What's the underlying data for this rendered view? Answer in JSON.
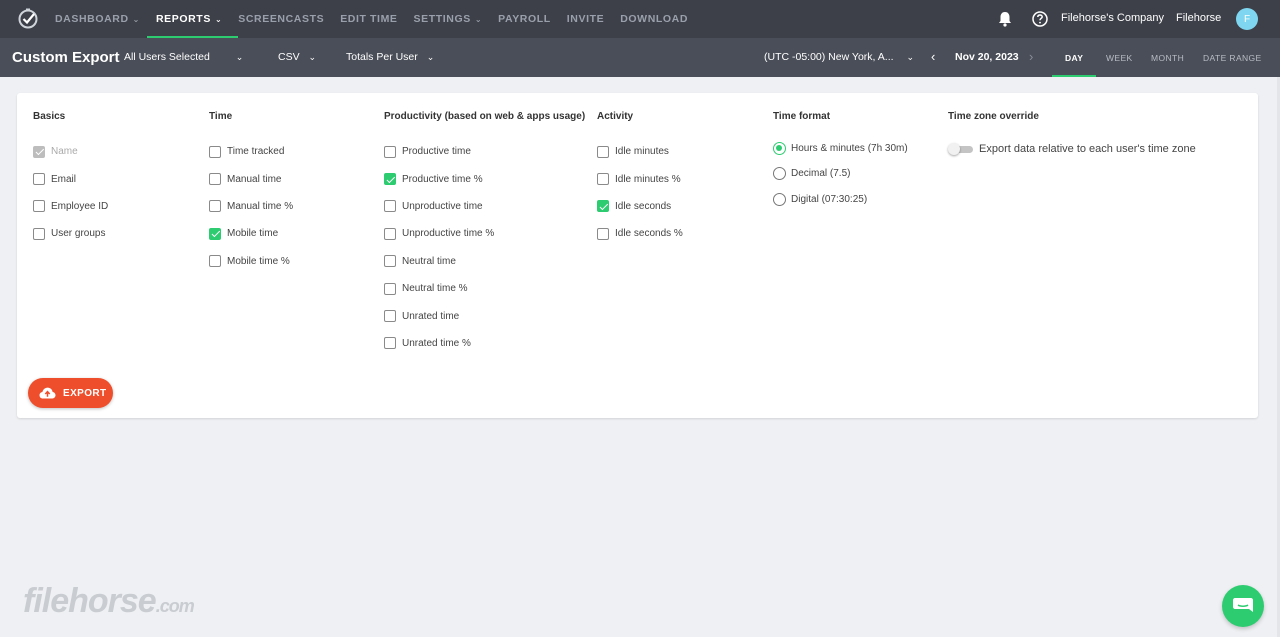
{
  "nav": {
    "items": [
      {
        "label": "DASHBOARD",
        "caret": true,
        "active": false
      },
      {
        "label": "REPORTS",
        "caret": true,
        "active": true
      },
      {
        "label": "SCREENCASTS",
        "caret": false,
        "active": false
      },
      {
        "label": "EDIT TIME",
        "caret": false,
        "active": false
      },
      {
        "label": "SETTINGS",
        "caret": true,
        "active": false
      },
      {
        "label": "PAYROLL",
        "caret": false,
        "active": false
      },
      {
        "label": "INVITE",
        "caret": false,
        "active": false
      },
      {
        "label": "DOWNLOAD",
        "caret": false,
        "active": false
      }
    ],
    "company": "Filehorse's Company",
    "user": "Filehorse",
    "avatar_initial": "F"
  },
  "subbar": {
    "title": "Custom Export",
    "users": "All Users Selected",
    "format": "CSV",
    "grouping": "Totals Per User",
    "timezone": "(UTC -05:00) New York, A...",
    "date": "Nov 20, 2023",
    "ranges": [
      "DAY",
      "WEEK",
      "MONTH",
      "DATE RANGE"
    ],
    "active_range": "DAY"
  },
  "columns": {
    "basics": {
      "title": "Basics",
      "options": [
        {
          "label": "Name",
          "checked": true,
          "disabled": true
        },
        {
          "label": "Email",
          "checked": false
        },
        {
          "label": "Employee ID",
          "checked": false
        },
        {
          "label": "User groups",
          "checked": false
        }
      ]
    },
    "time": {
      "title": "Time",
      "options": [
        {
          "label": "Time tracked",
          "checked": false
        },
        {
          "label": "Manual time",
          "checked": false
        },
        {
          "label": "Manual time %",
          "checked": false
        },
        {
          "label": "Mobile time",
          "checked": true
        },
        {
          "label": "Mobile time %",
          "checked": false
        }
      ]
    },
    "productivity": {
      "title": "Productivity (based on web & apps usage)",
      "options": [
        {
          "label": "Productive time",
          "checked": false
        },
        {
          "label": "Productive time %",
          "checked": true
        },
        {
          "label": "Unproductive time",
          "checked": false
        },
        {
          "label": "Unproductive time %",
          "checked": false
        },
        {
          "label": "Neutral time",
          "checked": false
        },
        {
          "label": "Neutral time %",
          "checked": false
        },
        {
          "label": "Unrated time",
          "checked": false
        },
        {
          "label": "Unrated time %",
          "checked": false
        }
      ]
    },
    "activity": {
      "title": "Activity",
      "options": [
        {
          "label": "Idle minutes",
          "checked": false
        },
        {
          "label": "Idle minutes %",
          "checked": false
        },
        {
          "label": "Idle seconds",
          "checked": true
        },
        {
          "label": "Idle seconds %",
          "checked": false
        }
      ]
    },
    "time_format": {
      "title": "Time format",
      "options": [
        {
          "label": "Hours & minutes (7h 30m)",
          "selected": true
        },
        {
          "label": "Decimal (7.5)",
          "selected": false
        },
        {
          "label": "Digital (07:30:25)",
          "selected": false
        }
      ]
    },
    "tz_override": {
      "title": "Time zone override",
      "toggle_label": "Export data relative to each user's time zone",
      "enabled": false
    }
  },
  "export_label": "EXPORT",
  "watermark": {
    "main": "filehorse",
    "suffix": ".com"
  },
  "colors": {
    "accent": "#2ecc71",
    "export": "#ee4e2b",
    "nav_bg": "#3d4049",
    "subbar_bg": "#4a4e58"
  }
}
